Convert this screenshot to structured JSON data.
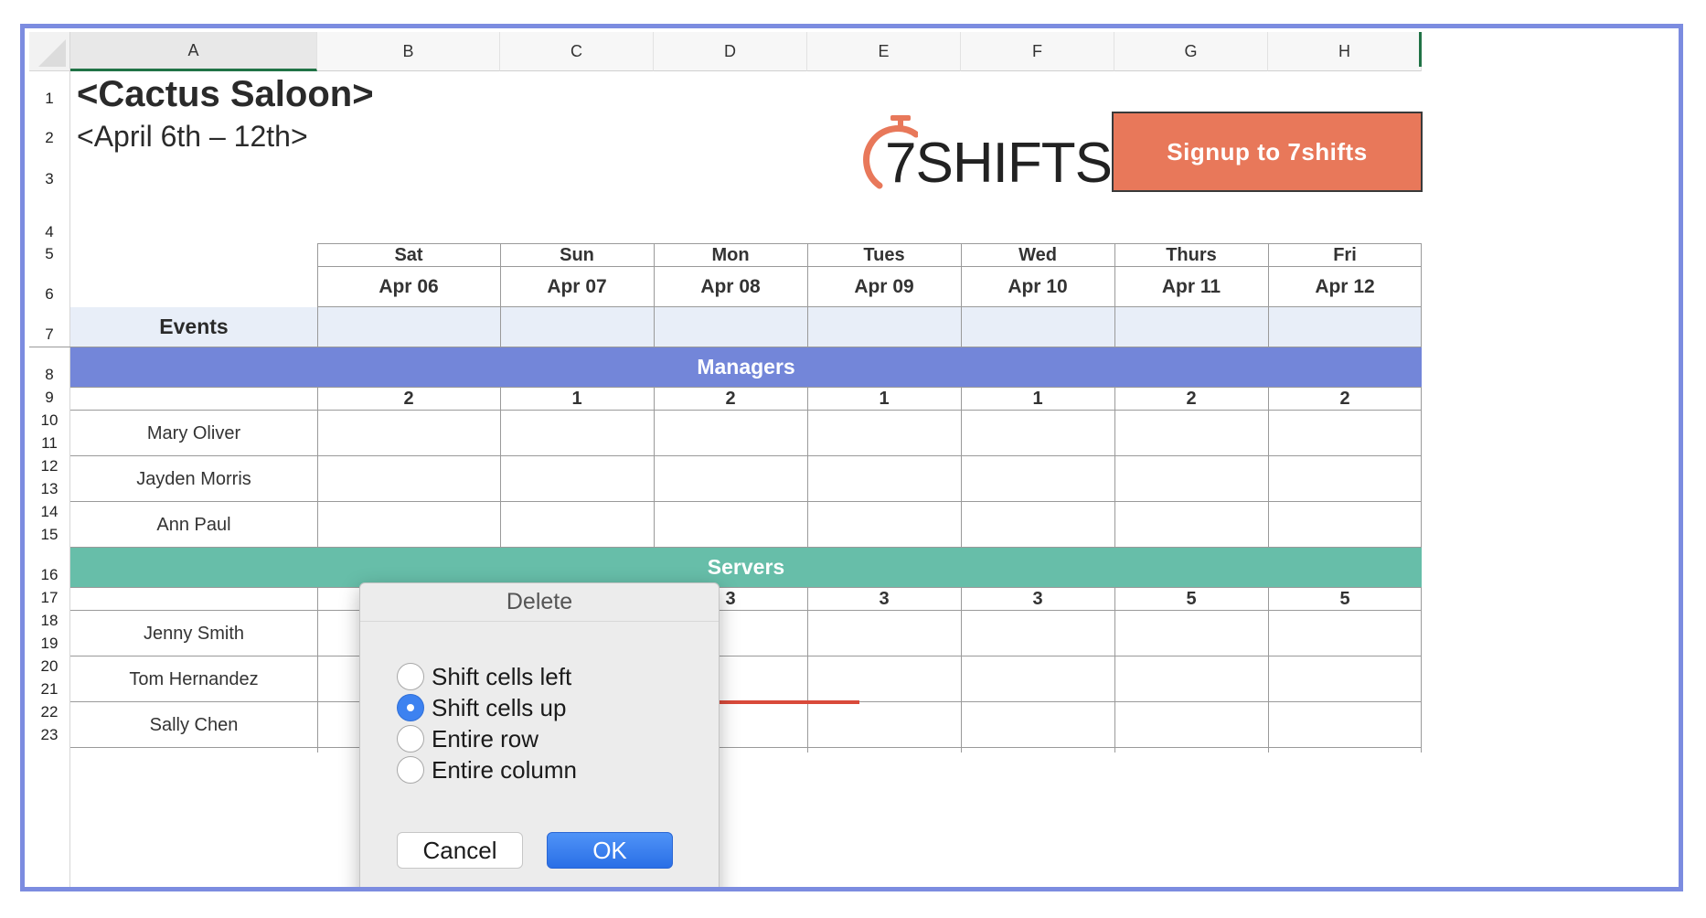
{
  "columns": [
    "A",
    "B",
    "C",
    "D",
    "E",
    "F",
    "G",
    "H"
  ],
  "rows": [
    "1",
    "2",
    "3",
    "4",
    "5",
    "6",
    "7",
    "8",
    "9",
    "10",
    "11",
    "12",
    "13",
    "14",
    "15",
    "16",
    "17",
    "18",
    "19",
    "20",
    "21",
    "22",
    "23"
  ],
  "title": "<Cactus Saloon>",
  "subtitle": "<April 6th – 12th>",
  "logo": {
    "text": "7SHIFTS",
    "icon": "stopwatch-icon",
    "color": "#222222",
    "accent": "#e8785a"
  },
  "signup_button": {
    "label": "Signup to 7shifts",
    "color": "#e8785a"
  },
  "days": [
    {
      "name": "Sat",
      "date": "Apr 06"
    },
    {
      "name": "Sun",
      "date": "Apr 07"
    },
    {
      "name": "Mon",
      "date": "Apr 08"
    },
    {
      "name": "Tues",
      "date": "Apr 09"
    },
    {
      "name": "Wed",
      "date": "Apr 10"
    },
    {
      "name": "Thurs",
      "date": "Apr 11"
    },
    {
      "name": "Fri",
      "date": "Apr 12"
    }
  ],
  "events_label": "Events",
  "managers": {
    "label": "Managers",
    "color": "#7386d9",
    "counts": [
      "2",
      "1",
      "2",
      "1",
      "1",
      "2",
      "2"
    ],
    "people": [
      "Mary Oliver",
      "Jayden Morris",
      "Ann Paul"
    ]
  },
  "servers": {
    "label": "Servers",
    "color": "#67bea9",
    "counts": [
      "",
      "",
      "3",
      "3",
      "3",
      "5",
      "5"
    ],
    "people": [
      "Jenny Smith",
      "Tom Hernandez",
      "Sally Chen"
    ]
  },
  "dialog": {
    "title": "Delete",
    "options": [
      {
        "label": "Shift cells left",
        "selected": false
      },
      {
        "label": "Shift cells up",
        "selected": true
      },
      {
        "label": "Entire row",
        "selected": false
      },
      {
        "label": "Entire column",
        "selected": false
      }
    ],
    "cancel_label": "Cancel",
    "ok_label": "OK"
  },
  "annotation_arrow": {
    "color": "#d94a3a",
    "points_to": "Shift cells up"
  }
}
